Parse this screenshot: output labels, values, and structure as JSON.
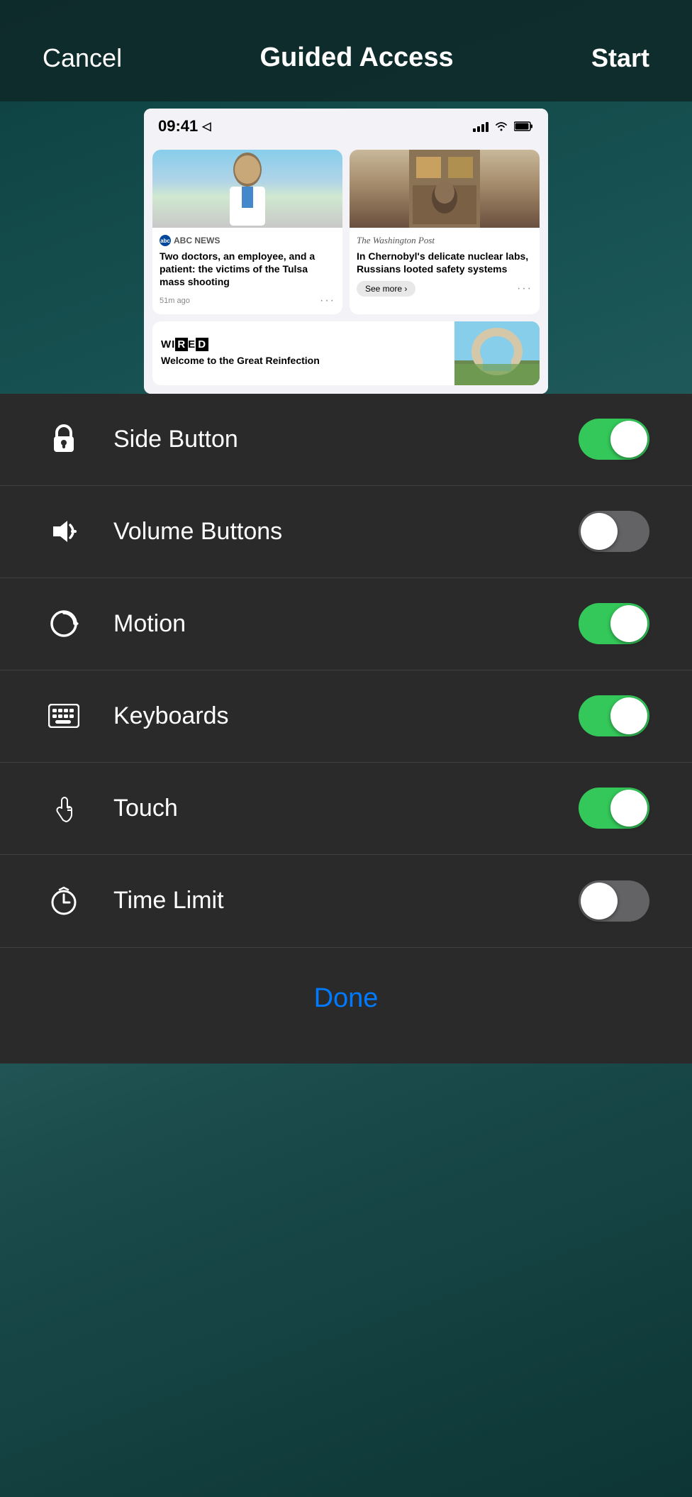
{
  "header": {
    "cancel_label": "Cancel",
    "title": "Guided Access",
    "start_label": "Start"
  },
  "status_bar": {
    "time": "09:41",
    "location_icon": "◁",
    "signal": "▐▌▌▌",
    "wifi": "wifi",
    "battery": "battery"
  },
  "news": {
    "card1": {
      "source": "ABC NEWS",
      "headline": "Two doctors, an employee, and a patient: the victims of the Tulsa mass shooting",
      "time": "51m ago"
    },
    "card2": {
      "source": "The Washington Post",
      "headline": "In Chernobyl's delicate nuclear labs, Russians looted safety systems",
      "see_more": "See more ›"
    },
    "card3": {
      "source": "WIRED",
      "headline": "Welcome to the Great Reinfection"
    }
  },
  "settings": {
    "items": [
      {
        "id": "side-button",
        "icon": "lock",
        "label": "Side Button",
        "enabled": true
      },
      {
        "id": "volume-buttons",
        "icon": "volume",
        "label": "Volume Buttons",
        "enabled": false
      },
      {
        "id": "motion",
        "icon": "motion",
        "label": "Motion",
        "enabled": true
      },
      {
        "id": "keyboards",
        "icon": "keyboard",
        "label": "Keyboards",
        "enabled": true
      },
      {
        "id": "touch",
        "icon": "touch",
        "label": "Touch",
        "enabled": true
      },
      {
        "id": "time-limit",
        "icon": "timer",
        "label": "Time Limit",
        "enabled": false
      }
    ],
    "done_label": "Done"
  }
}
